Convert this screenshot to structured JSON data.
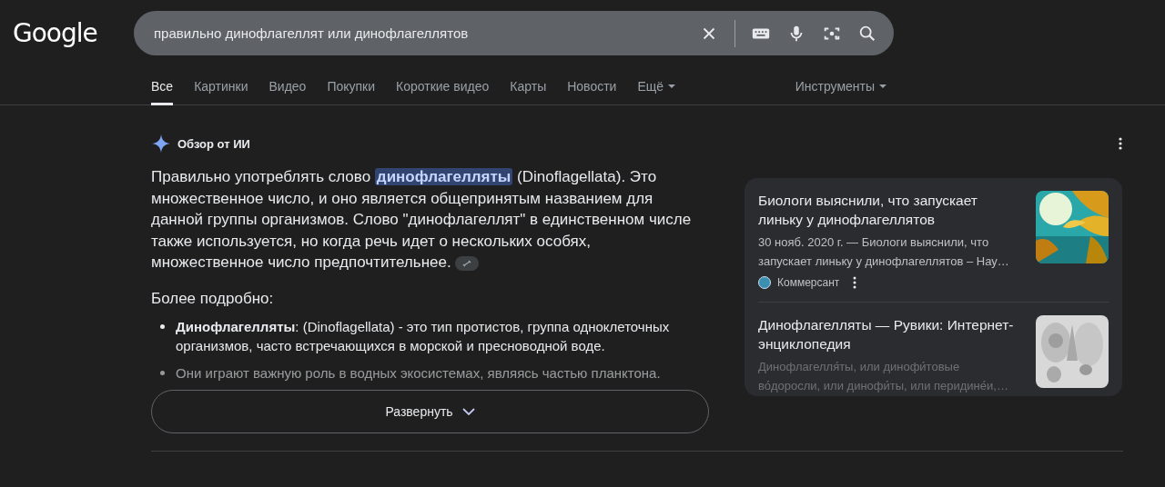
{
  "logo": "Google",
  "search": {
    "value": "правильно динофлагеллят или динофлагеллятов"
  },
  "tabs": [
    {
      "label": "Все",
      "selected": true
    },
    {
      "label": "Картинки",
      "selected": false
    },
    {
      "label": "Видео",
      "selected": false
    },
    {
      "label": "Покупки",
      "selected": false
    },
    {
      "label": "Короткие видео",
      "selected": false
    },
    {
      "label": "Карты",
      "selected": false
    },
    {
      "label": "Новости",
      "selected": false
    },
    {
      "label": "Ещё",
      "selected": false,
      "dropdown": true
    }
  ],
  "tools": "Инструменты",
  "ai_overview": {
    "title": "Обзор от ИИ",
    "answer": {
      "before": "Правильно употреблять слово ",
      "highlight": "динофлагелляты",
      "after": " (Dinoflagellata). Это множественное число, и оно является общепринятым названием для данной группы организмов. Слово \"динофлагеллят\" в единственном числе также используется, но когда речь идет о нескольких особях, множественное число предпочтительнее."
    },
    "more_heading": "Более подробно:",
    "bullets": [
      {
        "text": "**Динофлагелляты**: (Dinoflagellata) - это тип протистов, группа одноклеточных организмов, часто встречающихся в морской и пресноводной воде.",
        "faded": false
      },
      {
        "text": "Они играют важную роль в водных экосистемах, являясь частью планктона.",
        "faded": true
      }
    ],
    "expand_button": "Развернуть"
  },
  "sources": [
    {
      "title": "Биологи выяснили, что запускает линьку у динофлагеллятов",
      "snippet": "30 нояб. 2020 г. — Биологи выяснили, что запускает линьку у динофлагеллятов – Нау…",
      "site": "Коммерсант",
      "faded": false,
      "kind": "picture"
    },
    {
      "title": "Динофлагелляты — Рувики: Интернет-энциклопедия",
      "snippet": "Динофлагелля́ты, или динофи́товые во́доросли, или динофи́ты, или перидине́и,…",
      "faded": true,
      "kind": "picture"
    }
  ]
}
